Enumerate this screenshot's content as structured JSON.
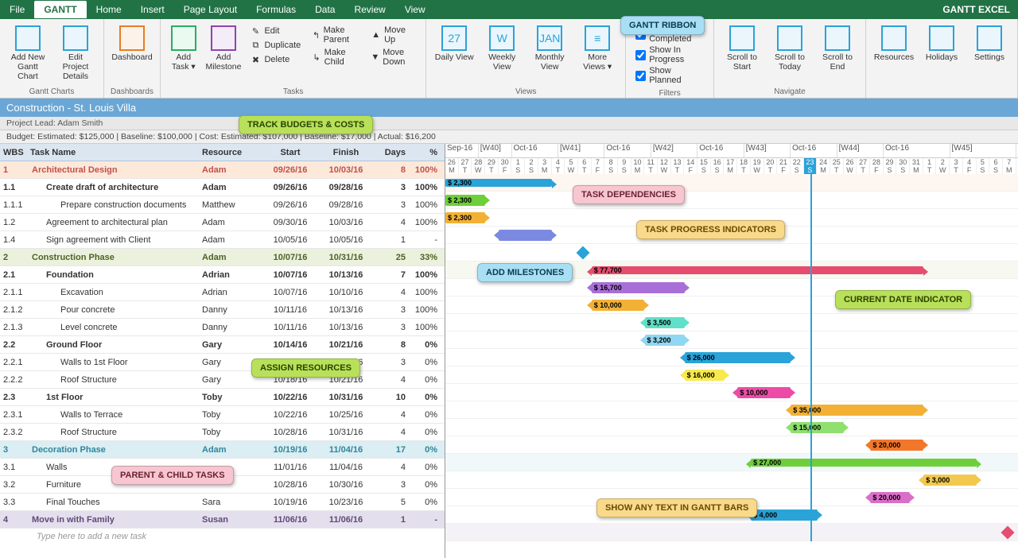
{
  "menu": {
    "items": [
      "File",
      "GANTT",
      "Home",
      "Insert",
      "Page Layout",
      "Formulas",
      "Data",
      "Review",
      "View"
    ],
    "active": 1,
    "brand": "GANTT EXCEL"
  },
  "ribbon": {
    "groups": {
      "ganttcharts": {
        "label": "Gantt Charts",
        "btns": [
          {
            "id": "add-gantt",
            "label": "Add New Gantt Chart"
          },
          {
            "id": "edit-details",
            "label": "Edit Project Details"
          }
        ]
      },
      "dashboards": {
        "label": "Dashboards",
        "btns": [
          {
            "id": "dashboard",
            "label": "Dashboard"
          }
        ]
      },
      "tasks": {
        "label": "Tasks",
        "btns": [
          {
            "id": "add-task",
            "label": "Add Task ▾"
          },
          {
            "id": "add-milestone",
            "label": "Add Milestone"
          }
        ],
        "small1": [
          {
            "icon": "✎",
            "t": "Edit"
          },
          {
            "icon": "⧉",
            "t": "Duplicate"
          },
          {
            "icon": "✖",
            "t": "Delete"
          }
        ],
        "small2": [
          {
            "icon": "↰",
            "t": "Make Parent"
          },
          {
            "icon": "↳",
            "t": "Make Child"
          }
        ],
        "small3": [
          {
            "icon": "▲",
            "t": "Move Up"
          },
          {
            "icon": "▼",
            "t": "Move Down"
          }
        ]
      },
      "views": {
        "label": "Views",
        "btns": [
          {
            "id": "daily",
            "label": "Daily View",
            "sub": "27"
          },
          {
            "id": "weekly",
            "label": "Weekly View",
            "sub": "W"
          },
          {
            "id": "monthly",
            "label": "Monthly View",
            "sub": "JAN"
          },
          {
            "id": "more",
            "label": "More Views ▾",
            "sub": "≡"
          }
        ]
      },
      "filters": {
        "label": "Filters",
        "checks": [
          {
            "id": "completed",
            "t": "Show Completed",
            "v": true
          },
          {
            "id": "inprogress",
            "t": "Show In Progress",
            "v": true
          },
          {
            "id": "planned",
            "t": "Show Planned",
            "v": true
          }
        ]
      },
      "navigate": {
        "label": "Navigate",
        "btns": [
          {
            "id": "scroll-start",
            "label": "Scroll to Start"
          },
          {
            "id": "scroll-today",
            "label": "Scroll to Today"
          },
          {
            "id": "scroll-end",
            "label": "Scroll to End"
          }
        ]
      },
      "other": {
        "btns": [
          {
            "id": "resources",
            "label": "Resources"
          },
          {
            "id": "holidays",
            "label": "Holidays"
          },
          {
            "id": "settings",
            "label": "Settings"
          }
        ]
      }
    }
  },
  "callouts": {
    "ribbon": "GANTT RIBBON",
    "budgets": "TRACK BUDGETS & COSTS",
    "dependencies": "TASK DEPENDENCIES",
    "milestones": "ADD MILESTONES",
    "progress": "TASK PROGRESS INDICATORS",
    "resources": "ASSIGN RESOURCES",
    "parentchild": "PARENT & CHILD TASKS",
    "current": "CURRENT DATE INDICATOR",
    "bartext": "SHOW ANY TEXT IN GANTT BARS"
  },
  "project": {
    "title": "Construction - St. Louis Villa",
    "lead": "Project Lead: Adam Smith",
    "budget": "Budget: Estimated: $125,000 | Baseline: $100,000 | Cost: Estimated: $107,000 | Baseline: $17,000 | Actual: $16,200"
  },
  "cols": {
    "wbs": "WBS",
    "task": "Task Name",
    "res": "Resource",
    "start": "Start",
    "fin": "Finish",
    "days": "Days",
    "pct": "%"
  },
  "newtask": "Type here to add a new task",
  "timeline": {
    "months": [
      {
        "m": "Sep-16",
        "w": "[W40]"
      },
      {
        "m": "Oct-16",
        "w": "[W41]"
      },
      {
        "m": "Oct-16",
        "w": "[W42]"
      },
      {
        "m": "Oct-16",
        "w": "[W43]"
      },
      {
        "m": "Oct-16",
        "w": "[W44]"
      },
      {
        "m": "Oct-16",
        "w": "[W45]"
      }
    ],
    "days": [
      "26",
      "27",
      "28",
      "29",
      "30",
      "1",
      "2",
      "3",
      "4",
      "5",
      "6",
      "7",
      "8",
      "9",
      "10",
      "11",
      "12",
      "13",
      "14",
      "15",
      "16",
      "17",
      "18",
      "19",
      "20",
      "21",
      "22",
      "23",
      "24",
      "25",
      "26",
      "27",
      "28",
      "29",
      "30",
      "31",
      "1",
      "2",
      "3",
      "4",
      "5",
      "6",
      "7"
    ],
    "wk": [
      "M",
      "T",
      "W",
      "T",
      "F",
      "S",
      "S",
      "M",
      "T",
      "W",
      "T",
      "F",
      "S",
      "S",
      "M",
      "T",
      "W",
      "T",
      "F",
      "S",
      "S",
      "M",
      "T",
      "W",
      "T",
      "F",
      "S",
      "S",
      "M",
      "T",
      "W",
      "T",
      "F",
      "S",
      "S",
      "M",
      "T",
      "W",
      "T",
      "F",
      "S",
      "S",
      "M"
    ],
    "todayIndex": 27
  },
  "rows": [
    {
      "wbs": "1",
      "name": "Architectural Design",
      "res": "Adam",
      "s": "09/26/16",
      "f": "10/03/16",
      "d": "8",
      "p": "100%",
      "cls": "sum1",
      "indent": 0,
      "bar": {
        "a": 0,
        "b": 8,
        "color": "#2aa3d8",
        "text": "$ 2,300",
        "sum": true
      }
    },
    {
      "wbs": "1.1",
      "name": "Create draft of architecture",
      "res": "Adam",
      "s": "09/26/16",
      "f": "09/28/16",
      "d": "3",
      "p": "100%",
      "cls": "bold",
      "indent": 1,
      "bar": {
        "a": 0,
        "b": 3,
        "color": "#6ecf3a",
        "text": "$ 2,300"
      }
    },
    {
      "wbs": "1.1.1",
      "name": "Prepare construction documents",
      "res": "Matthew",
      "s": "09/26/16",
      "f": "09/28/16",
      "d": "3",
      "p": "100%",
      "indent": 2,
      "bar": {
        "a": 0,
        "b": 3,
        "color": "#f2b134",
        "text": "$ 2,300"
      }
    },
    {
      "wbs": "1.2",
      "name": "Agreement to architectural plan",
      "res": "Adam",
      "s": "09/30/16",
      "f": "10/03/16",
      "d": "4",
      "p": "100%",
      "indent": 1,
      "bar": {
        "a": 4,
        "b": 8,
        "color": "#7b8ae0",
        "text": ""
      }
    },
    {
      "wbs": "1.4",
      "name": "Sign agreement with Client",
      "res": "Adam",
      "s": "10/05/16",
      "f": "10/05/16",
      "d": "1",
      "p": "-",
      "indent": 1,
      "mile": {
        "a": 10,
        "color": "#2aa3d8"
      }
    },
    {
      "wbs": "2",
      "name": "Construction Phase",
      "res": "Adam",
      "s": "10/07/16",
      "f": "10/31/16",
      "d": "25",
      "p": "33%",
      "cls": "sum2",
      "indent": 0,
      "bar": {
        "a": 11,
        "b": 36,
        "color": "#e64c6e",
        "text": "$ 77,700",
        "sum": true
      }
    },
    {
      "wbs": "2.1",
      "name": "Foundation",
      "res": "Adrian",
      "s": "10/07/16",
      "f": "10/13/16",
      "d": "7",
      "p": "100%",
      "cls": "bold",
      "indent": 1,
      "bar": {
        "a": 11,
        "b": 18,
        "color": "#a86fd8",
        "text": "$ 16,700"
      }
    },
    {
      "wbs": "2.1.1",
      "name": "Excavation",
      "res": "Adrian",
      "s": "10/07/16",
      "f": "10/10/16",
      "d": "4",
      "p": "100%",
      "indent": 2,
      "bar": {
        "a": 11,
        "b": 15,
        "color": "#f2b134",
        "text": "$ 10,000"
      }
    },
    {
      "wbs": "2.1.2",
      "name": "Pour concrete",
      "res": "Danny",
      "s": "10/11/16",
      "f": "10/13/16",
      "d": "3",
      "p": "100%",
      "indent": 2,
      "bar": {
        "a": 15,
        "b": 18,
        "color": "#5fe0c8",
        "text": "$ 3,500"
      }
    },
    {
      "wbs": "2.1.3",
      "name": "Level concrete",
      "res": "Danny",
      "s": "10/11/16",
      "f": "10/13/16",
      "d": "3",
      "p": "100%",
      "indent": 2,
      "bar": {
        "a": 15,
        "b": 18,
        "color": "#8fd7f2",
        "text": "$ 3,200"
      }
    },
    {
      "wbs": "2.2",
      "name": "Ground Floor",
      "res": "Gary",
      "s": "10/14/16",
      "f": "10/21/16",
      "d": "8",
      "p": "0%",
      "cls": "bold",
      "indent": 1,
      "bar": {
        "a": 18,
        "b": 26,
        "color": "#2aa3d8",
        "text": "$ 26,000"
      }
    },
    {
      "wbs": "2.2.1",
      "name": "Walls to 1st Floor",
      "res": "Gary",
      "s": "10/14/16",
      "f": "10/16/16",
      "d": "3",
      "p": "0%",
      "indent": 2,
      "bar": {
        "a": 18,
        "b": 21,
        "color": "#f7e94e",
        "text": "$ 16,000"
      }
    },
    {
      "wbs": "2.2.2",
      "name": "Roof Structure",
      "res": "Gary",
      "s": "10/18/16",
      "f": "10/21/16",
      "d": "4",
      "p": "0%",
      "indent": 2,
      "bar": {
        "a": 22,
        "b": 26,
        "color": "#ec4ca5",
        "text": "$ 10,000"
      }
    },
    {
      "wbs": "2.3",
      "name": "1st Floor",
      "res": "Toby",
      "s": "10/22/16",
      "f": "10/31/16",
      "d": "10",
      "p": "0%",
      "cls": "bold",
      "indent": 1,
      "bar": {
        "a": 26,
        "b": 36,
        "color": "#f2b134",
        "text": "$ 35,000"
      }
    },
    {
      "wbs": "2.3.1",
      "name": "Walls to Terrace",
      "res": "Toby",
      "s": "10/22/16",
      "f": "10/25/16",
      "d": "4",
      "p": "0%",
      "indent": 2,
      "bar": {
        "a": 26,
        "b": 30,
        "color": "#8fe06f",
        "text": "$ 15,000"
      }
    },
    {
      "wbs": "2.3.2",
      "name": "Roof Structure",
      "res": "Toby",
      "s": "10/28/16",
      "f": "10/31/16",
      "d": "4",
      "p": "0%",
      "indent": 2,
      "bar": {
        "a": 32,
        "b": 36,
        "color": "#f2772a",
        "text": "$ 20,000"
      }
    },
    {
      "wbs": "3",
      "name": "Decoration Phase",
      "res": "Adam",
      "s": "10/19/16",
      "f": "11/04/16",
      "d": "17",
      "p": "0%",
      "cls": "sum3",
      "indent": 0,
      "bar": {
        "a": 23,
        "b": 40,
        "color": "#6ecf3a",
        "text": "$ 27,000",
        "sum": true
      }
    },
    {
      "wbs": "3.1",
      "name": "Walls",
      "res": "",
      "s": "11/01/16",
      "f": "11/04/16",
      "d": "4",
      "p": "0%",
      "indent": 1,
      "bar": {
        "a": 36,
        "b": 40,
        "color": "#f2c94e",
        "text": "$ 3,000"
      }
    },
    {
      "wbs": "3.2",
      "name": "Furniture",
      "res": "",
      "s": "10/28/16",
      "f": "10/30/16",
      "d": "3",
      "p": "0%",
      "indent": 1,
      "bar": {
        "a": 32,
        "b": 35,
        "color": "#d96fc8",
        "text": "$ 20,000"
      }
    },
    {
      "wbs": "3.3",
      "name": "Final Touches",
      "res": "Sara",
      "s": "10/19/16",
      "f": "10/23/16",
      "d": "5",
      "p": "0%",
      "indent": 1,
      "bar": {
        "a": 23,
        "b": 28,
        "color": "#2aa3d8",
        "text": "$ 4,000"
      }
    },
    {
      "wbs": "4",
      "name": "Move in with Family",
      "res": "Susan",
      "s": "11/06/16",
      "f": "11/06/16",
      "d": "1",
      "p": "-",
      "cls": "sum4",
      "indent": 0,
      "mile": {
        "a": 42,
        "color": "#e64c6e"
      }
    }
  ]
}
